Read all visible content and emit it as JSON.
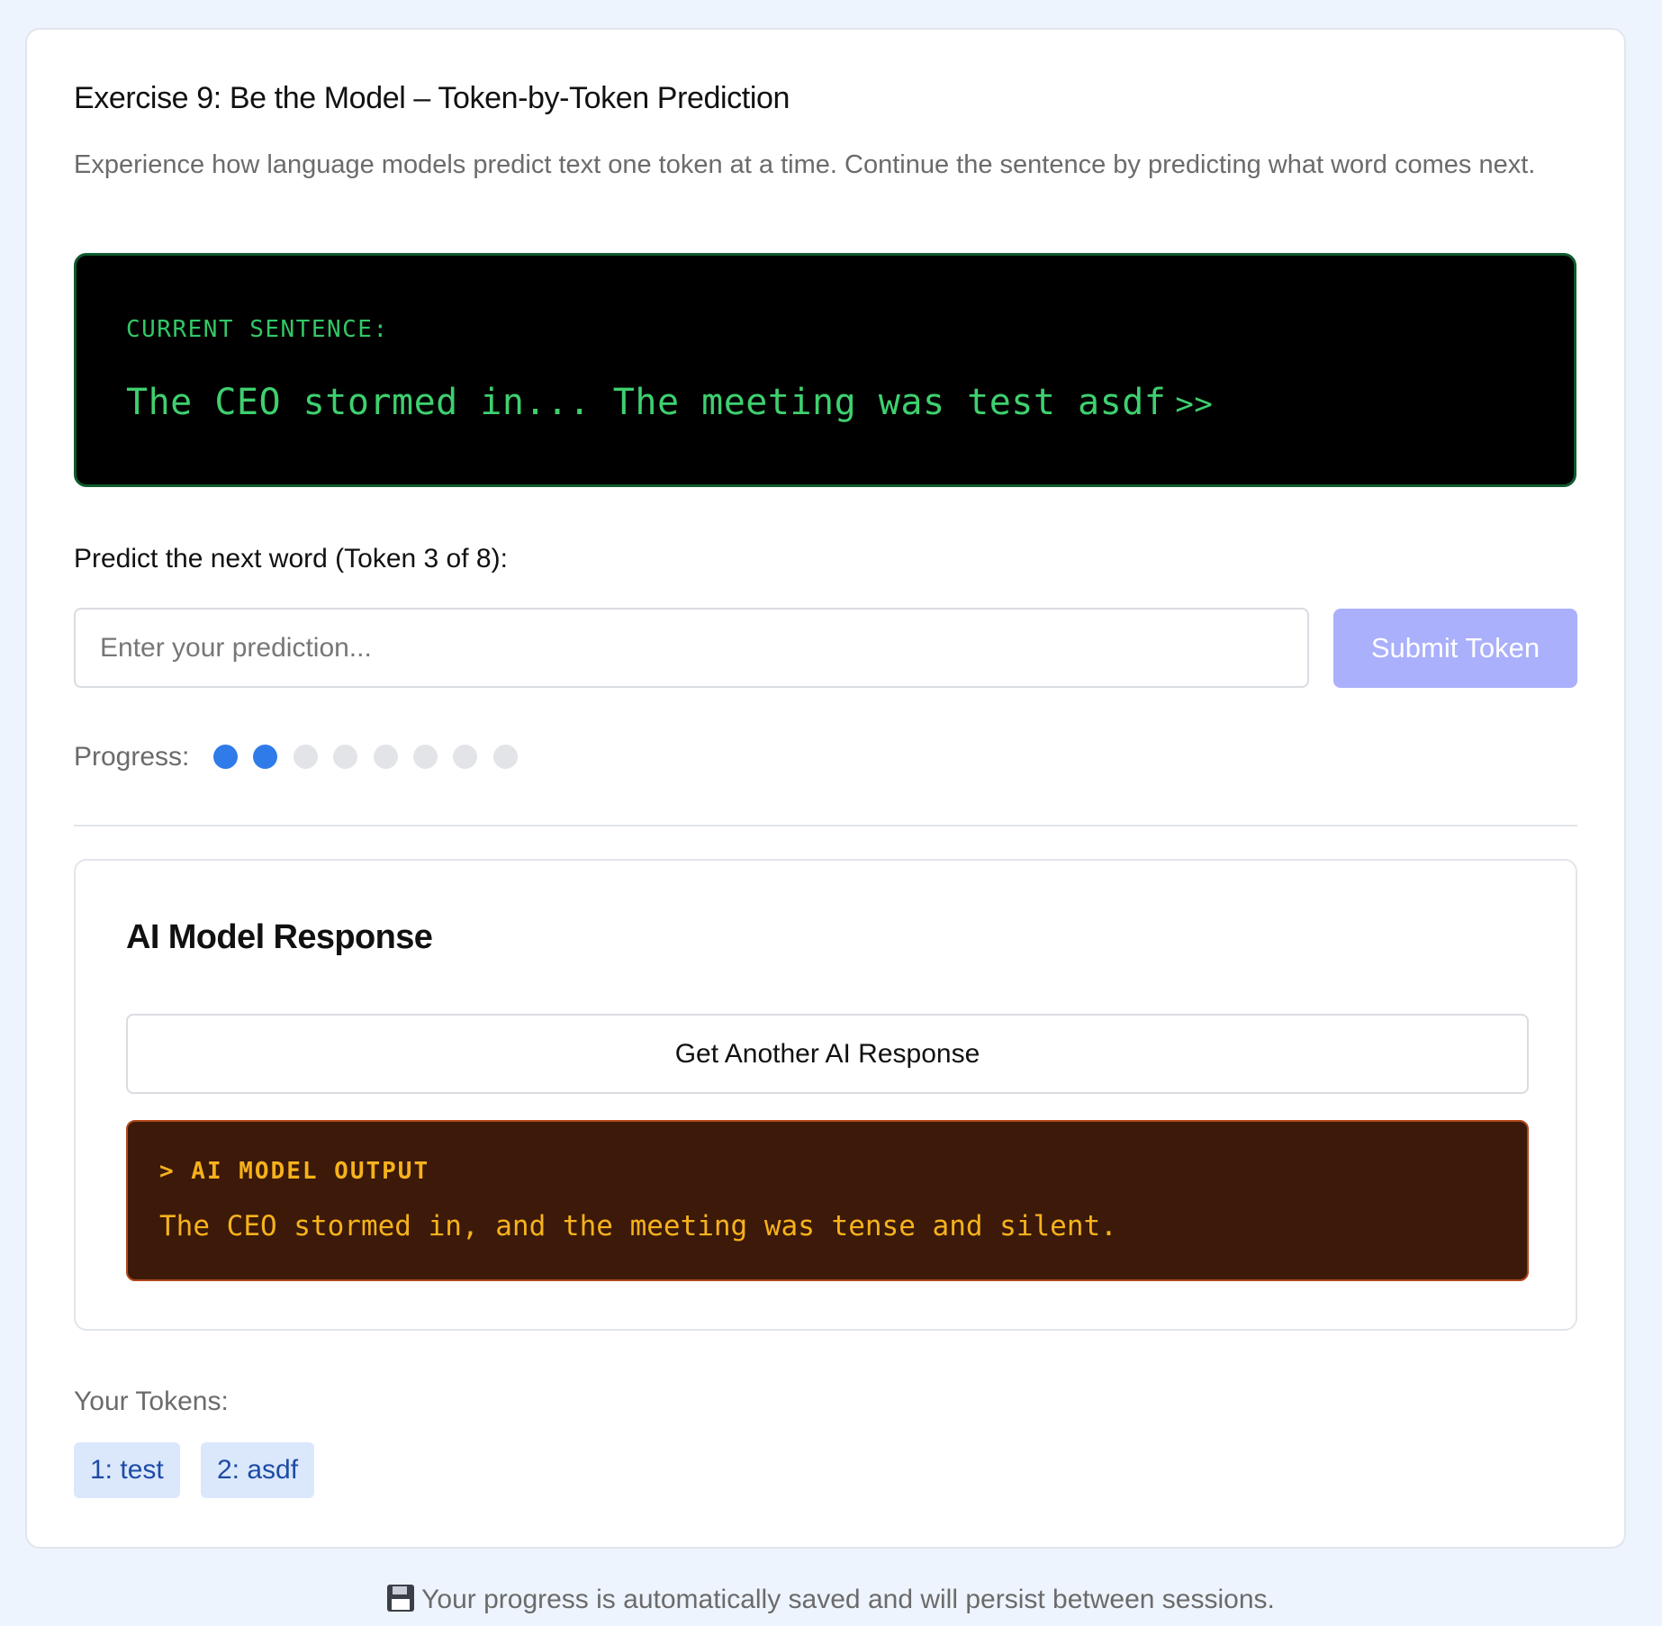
{
  "exercise": {
    "title": "Exercise 9: Be the Model – Token-by-Token Prediction",
    "description": "Experience how language models predict text one token at a time. Continue the sentence by predicting what word comes next."
  },
  "terminal": {
    "label": "CURRENT SENTENCE:",
    "sentence": "The CEO stormed in... The meeting was test asdf",
    "cursor": ">>"
  },
  "prediction": {
    "label": "Predict the next word (Token 3 of 8):",
    "input_value": "",
    "input_placeholder": "Enter your prediction...",
    "submit_label": "Submit Token"
  },
  "progress": {
    "label": "Progress:",
    "completed": 2,
    "total": 8
  },
  "ai_response": {
    "title": "AI Model Response",
    "button_label": "Get Another AI Response",
    "output_label": "> AI MODEL OUTPUT",
    "output_text": "The CEO stormed in, and the meeting was tense and silent."
  },
  "tokens": {
    "label": "Your Tokens:",
    "items": [
      "1: test",
      "2: asdf"
    ]
  },
  "footer": {
    "icon": "floppy-disk-icon",
    "text": "Your progress is automatically saved and will persist between sessions."
  },
  "colors": {
    "page_background": "#edf4fd",
    "terminal_text": "#3ed06f",
    "submit_button": "#aab0fb",
    "progress_done": "#2f7bea",
    "progress_pending": "#e3e4e8",
    "ai_output_background": "#3c1908",
    "ai_output_text": "#f6b21c",
    "token_chip": "#dbe7fb"
  }
}
